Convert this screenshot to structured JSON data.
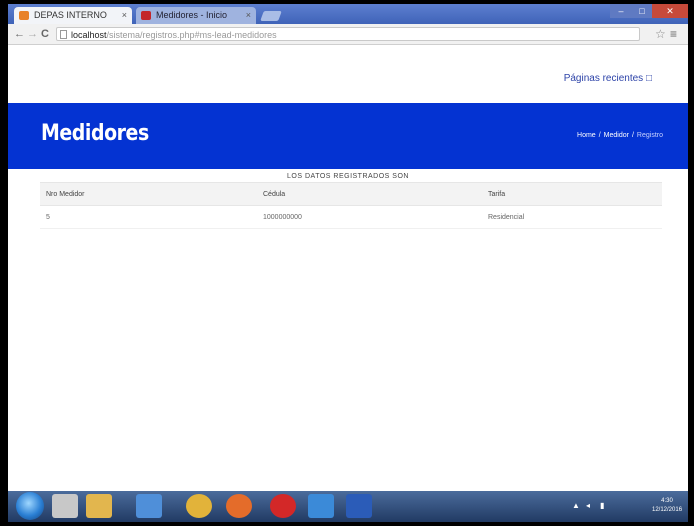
{
  "browser": {
    "tabs": [
      {
        "title": "DEPAS INTERNO",
        "close": "×",
        "active": true,
        "favicon_color": "#e8822a"
      },
      {
        "title": "Medidores - Inicio",
        "close": "×",
        "active": false,
        "favicon_color": "#c3262b"
      }
    ],
    "window_controls": {
      "minimize": "–",
      "maximize": "□",
      "close": "✕"
    },
    "nav": {
      "back": "←",
      "forward": "→",
      "reload": "C"
    },
    "url_host": "localhost",
    "url_path": "/sistema/registros.php#ms-lead-medidores",
    "star": "☆",
    "menu": "≡"
  },
  "page": {
    "nav_link": "Páginas recientes □",
    "banner": {
      "title": "Medidores",
      "breadcrumb": [
        "Home",
        "Medidor",
        "Registro"
      ],
      "breadcrumb_separator": "/"
    },
    "table": {
      "caption": "LOS DATOS REGISTRADOS SON",
      "headers": [
        "Nro Medidor",
        "Cédula",
        "Tarifa"
      ],
      "rows": [
        [
          "5",
          "1000000000",
          "Residencial"
        ]
      ]
    }
  },
  "taskbar": {
    "apps": [
      {
        "name": "explorer-icon",
        "color": "#c8c8c8"
      },
      {
        "name": "folder-icon",
        "color": "#e2b64e"
      },
      {
        "name": "paint-icon",
        "color": "#4f8fd9"
      },
      {
        "name": "chrome-icon",
        "color": "#e2b33a"
      },
      {
        "name": "firefox-icon",
        "color": "#e46c2a"
      },
      {
        "name": "opera-icon",
        "color": "#d32828"
      },
      {
        "name": "ie-icon",
        "color": "#3b8ad8"
      },
      {
        "name": "word-icon",
        "color": "#2b5cb8"
      }
    ],
    "tray_icons": [
      "▲",
      "◂",
      "▮"
    ],
    "clock_time": "4:30",
    "clock_date": "12/12/2016"
  },
  "colors": {
    "banner": "#0433d2",
    "link": "#2d43a8"
  }
}
